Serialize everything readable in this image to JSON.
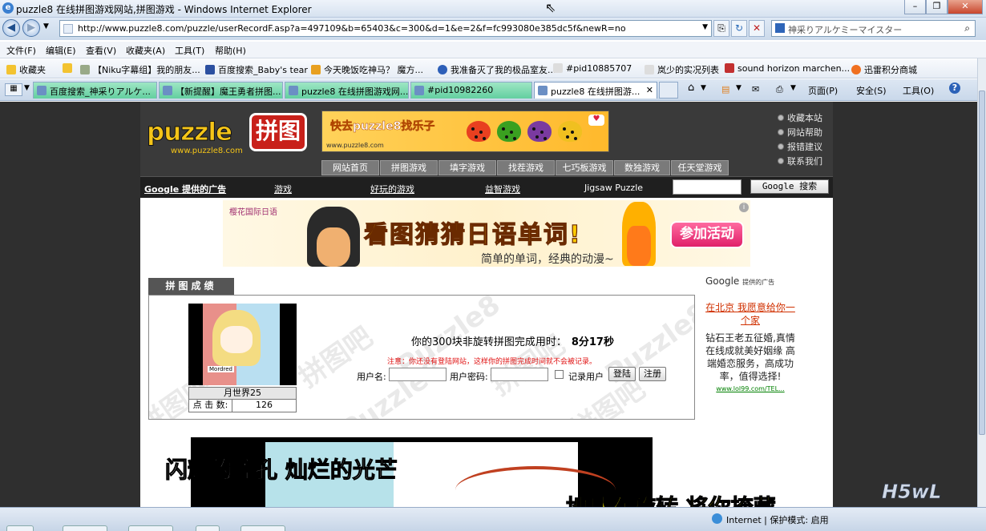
{
  "window": {
    "title": "puzzle8 在线拼图游戏网站,拼图游戏 - Windows Internet Explorer"
  },
  "address": {
    "url": "http://www.puzzle8.com/puzzle/userRecordF.asp?a=497109&b=65403&c=300&d=1&e=2&f=fc993080e385dc5f&newR=no"
  },
  "search": {
    "placeholder": "神采りアルケミーマイスター"
  },
  "menu": [
    "文件(F)",
    "编辑(E)",
    "查看(V)",
    "收藏夹(A)",
    "工具(T)",
    "帮助(H)"
  ],
  "favorites": {
    "label": "收藏夹",
    "items": [
      "【Niku字幕组】我的朋友...",
      "百度搜索_Baby's tear",
      "今天晚饭吃神马？ 魔方...",
      "我准备灭了我的极品室友...",
      "#pid10885707",
      "岚少的实况列表",
      "sound horizon marchen...",
      "迅雷积分商城"
    ]
  },
  "tabs": [
    "百度搜索_神采りアルケ...",
    "【新提醒】魔王勇者拼图...",
    "puzzle8 在线拼图游戏网...",
    "#pid10982260",
    "puzzle8 在线拼图游..."
  ],
  "commands": {
    "page": "页面(P)",
    "safety": "安全(S)",
    "tools": "工具(O)"
  },
  "site": {
    "logo": "puzzle",
    "logo_badge": "拼图",
    "logo_url": "www.puzzle8.com",
    "top_banner": {
      "text": "快去puzzle8找乐子",
      "url": "www.puzzle8.com"
    },
    "side_links": [
      "收藏本站",
      "网站帮助",
      "报错建议",
      "联系我们"
    ],
    "nav": [
      "网站首页",
      "拼图游戏",
      "填字游戏",
      "找茬游戏",
      "七巧板游戏",
      "数独游戏",
      "任天堂游戏"
    ],
    "adbar": {
      "google": "Google 提供的广告",
      "links": [
        "游戏",
        "好玩的游戏",
        "益智游戏"
      ],
      "jigsaw": "Jigsaw Puzzle",
      "search_button": "Google 搜索"
    }
  },
  "ad_banner": {
    "school": "樱花国际日语",
    "headline": "看图猜猜日语单词!",
    "sub": "简单的单词，经典的动漫~",
    "cta": "参加活动",
    "info": "i"
  },
  "result": {
    "tab_label": "拼图成绩",
    "thumb_label": "Mordred",
    "puzzle_title": "月世界25",
    "clicks_label": "点 击 数:",
    "clicks": "126",
    "message": "你的300块非旋转拼图完成用时：",
    "time": "8分17秒",
    "notice": "注意：你还没有登陆网站，这样你的拼图完成时间就不会被记录。",
    "username_label": "用户名:",
    "password_label": "用户密码:",
    "remember_label": "记录用户",
    "login_button": "登陆",
    "register_button": "注册"
  },
  "watermarks": {
    "a": "Puzzle8",
    "b": "拼图吧"
  },
  "google_ads": {
    "header": "Google",
    "header_small": "提供的广告",
    "title": "在北京 我愿意给你一个家",
    "body": "钻石王老五征婚,真情在线成就美好姻缘 高端婚恋服务，高成功率，值得选择!",
    "url": "www.lol99.com/TEL..."
  },
  "subtitles": {
    "line1": "闪耀的瞳孔 灿烂的光芒",
    "line2": "地球在旋转 将你掩藏"
  },
  "status": {
    "zone": "Internet | 保护模式: 启用"
  },
  "overlay_logo": "H5wL"
}
